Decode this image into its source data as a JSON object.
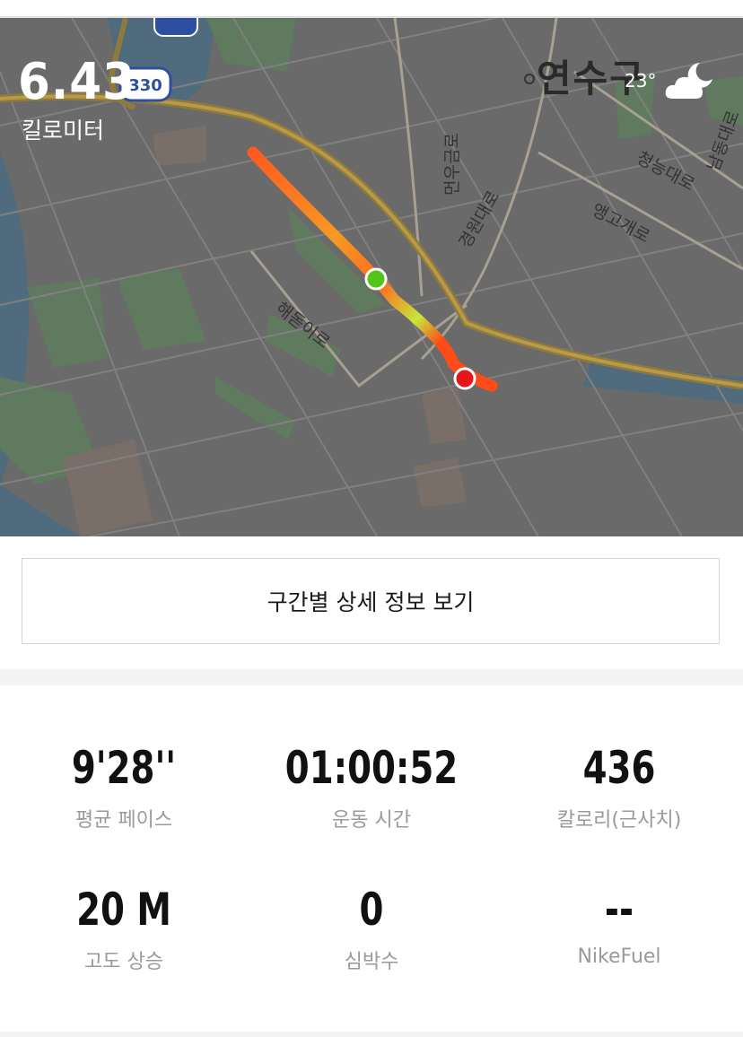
{
  "map": {
    "distance_value": "6.43",
    "distance_unit": "킬로미터",
    "district": "연수구",
    "temperature": "23°",
    "weather_icon": "partly-cloudy-night-icon",
    "route_sign": "330",
    "streets": [
      "청능대로",
      "앵고개로",
      "경원대로",
      "먼우금로",
      "해돋이로",
      "남동대로"
    ]
  },
  "segment_button": {
    "label": "구간별 상세 정보 보기"
  },
  "stats": [
    {
      "value": "9'28''",
      "label": "평균 페이스"
    },
    {
      "value": "01:00:52",
      "label": "운동 시간"
    },
    {
      "value": "436",
      "label": "칼로리(근사치)"
    },
    {
      "value": "20 M",
      "label": "고도 상승"
    },
    {
      "value": "0",
      "label": "심박수"
    },
    {
      "value": "--",
      "label": "NikeFuel"
    }
  ],
  "colors": {
    "route_start": "#ff5a1f",
    "route_mid": "#f59a23",
    "route_highlight": "#c8e63a",
    "start_marker": "#52c41a",
    "end_marker": "#e8141c"
  }
}
